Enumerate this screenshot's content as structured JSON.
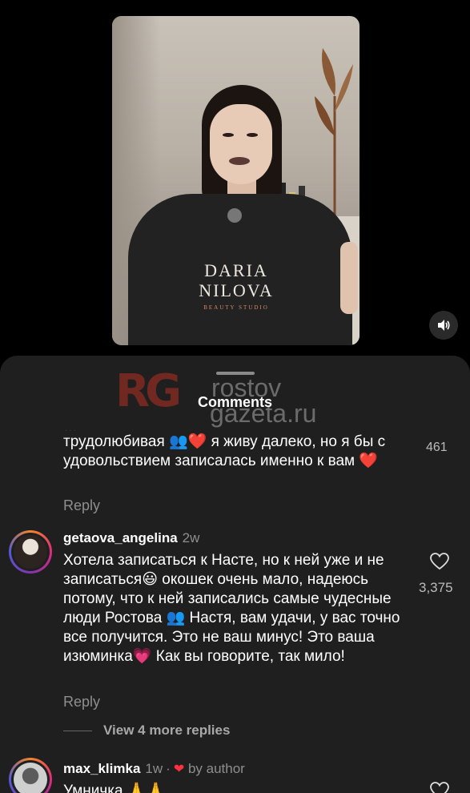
{
  "video": {
    "shirt_brand_line1": "DARIA",
    "shirt_brand_line2": "NILOVA",
    "shirt_brand_line3": "BEAUTY STUDIO"
  },
  "sheet": {
    "title": "Comments",
    "watermark_line1": "rostov",
    "watermark_line2": "gazeta.ru",
    "watermark_logo": "RG"
  },
  "comments": [
    {
      "text_cut": "...",
      "text": "трудолюбивая 👥❤️ я живу далеко, но я бы с удовольствием записалась именно к вам ❤️",
      "likes": "461",
      "reply_label": "Reply"
    },
    {
      "username": "getaova_angelina",
      "time": "2w",
      "text": "Хотела записаться к Насте, но к ней уже и не записаться😃 окошек очень мало, надеюсь потому, что к ней записались самые чудесные люди Ростова 👥 Настя, вам удачи, у вас точно все получится. Это не ваш минус! Это ваша изюминка💗 Как вы говорите, так мило!",
      "likes": "3,375",
      "reply_label": "Reply",
      "view_more": "View 4 more replies"
    },
    {
      "username": "max_klimka",
      "time": "1w",
      "by_author": "by author",
      "text": "Умничка 🙏🙏"
    }
  ],
  "colors": {
    "background": "#000000",
    "sheet": "#1f1f1f",
    "muted_text": "#8e8e8e",
    "heart": "#ff3040"
  }
}
